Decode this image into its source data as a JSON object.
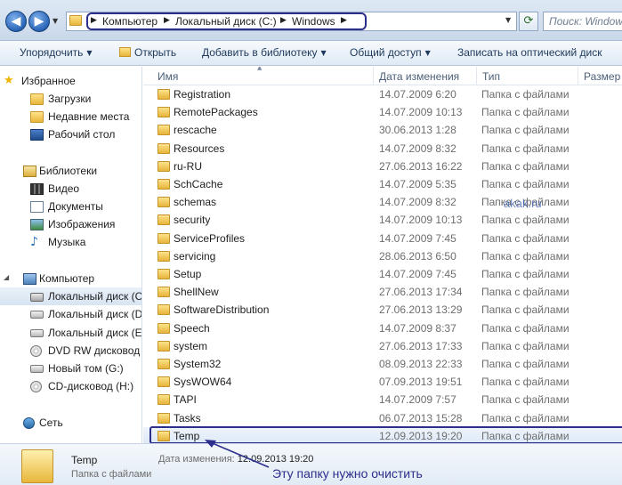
{
  "address_bar": {
    "crumbs": [
      "Компьютер",
      "Локальный диск (C:)",
      "Windows"
    ],
    "search_placeholder": "Поиск: Window"
  },
  "toolbar": {
    "organize": "Упорядочить",
    "open": "Открыть",
    "add_to_library": "Добавить в библиотеку",
    "share": "Общий доступ",
    "burn": "Записать на оптический диск"
  },
  "nav": {
    "favorites": "Избранное",
    "downloads": "Загрузки",
    "recent": "Недавние места",
    "desktop": "Рабочий стол",
    "libraries": "Библиотеки",
    "video": "Видео",
    "documents": "Документы",
    "images": "Изображения",
    "music": "Музыка",
    "computer": "Компьютер",
    "drive_c": "Локальный диск (C",
    "drive_d": "Локальный диск (D",
    "drive_e": "Локальный диск (E:",
    "dvd": "DVD RW дисковод (",
    "new_volume": "Новый том (G:)",
    "cd": "CD-дисковод (H:)",
    "network": "Сеть"
  },
  "columns": {
    "name": "Имя",
    "modified": "Дата изменения",
    "type": "Тип",
    "size": "Размер"
  },
  "files": [
    {
      "name": "Registration",
      "date": "14.07.2009 6:20",
      "type": "Папка с файлами"
    },
    {
      "name": "RemotePackages",
      "date": "14.07.2009 10:13",
      "type": "Папка с файлами"
    },
    {
      "name": "rescache",
      "date": "30.06.2013 1:28",
      "type": "Папка с файлами"
    },
    {
      "name": "Resources",
      "date": "14.07.2009 8:32",
      "type": "Папка с файлами"
    },
    {
      "name": "ru-RU",
      "date": "27.06.2013 16:22",
      "type": "Папка с файлами"
    },
    {
      "name": "SchCache",
      "date": "14.07.2009 5:35",
      "type": "Папка с файлами"
    },
    {
      "name": "schemas",
      "date": "14.07.2009 8:32",
      "type": "Папка с файлами"
    },
    {
      "name": "security",
      "date": "14.07.2009 10:13",
      "type": "Папка с файлами"
    },
    {
      "name": "ServiceProfiles",
      "date": "14.07.2009 7:45",
      "type": "Папка с файлами"
    },
    {
      "name": "servicing",
      "date": "28.06.2013 6:50",
      "type": "Папка с файлами"
    },
    {
      "name": "Setup",
      "date": "14.07.2009 7:45",
      "type": "Папка с файлами"
    },
    {
      "name": "ShellNew",
      "date": "27.06.2013 17:34",
      "type": "Папка с файлами"
    },
    {
      "name": "SoftwareDistribution",
      "date": "27.06.2013 13:29",
      "type": "Папка с файлами"
    },
    {
      "name": "Speech",
      "date": "14.07.2009 8:37",
      "type": "Папка с файлами"
    },
    {
      "name": "system",
      "date": "27.06.2013 17:33",
      "type": "Папка с файлами"
    },
    {
      "name": "System32",
      "date": "08.09.2013 22:33",
      "type": "Папка с файлами"
    },
    {
      "name": "SysWOW64",
      "date": "07.09.2013 19:51",
      "type": "Папка с файлами"
    },
    {
      "name": "TAPI",
      "date": "14.07.2009 7:57",
      "type": "Папка с файлами"
    },
    {
      "name": "Tasks",
      "date": "06.07.2013 15:28",
      "type": "Папка с файлами"
    },
    {
      "name": "Temp",
      "date": "12.09.2013 19:20",
      "type": "Папка с файлами"
    }
  ],
  "watermark": "akak.ru",
  "details": {
    "name": "Temp",
    "type": "Папка с файлами",
    "modified_label": "Дата изменения:",
    "modified_value": "12.09.2013 19:20",
    "annotation": "Эту папку нужно очистить"
  },
  "colors": {
    "annotation": "#2c2e8c",
    "folder": "#e6b43a"
  }
}
